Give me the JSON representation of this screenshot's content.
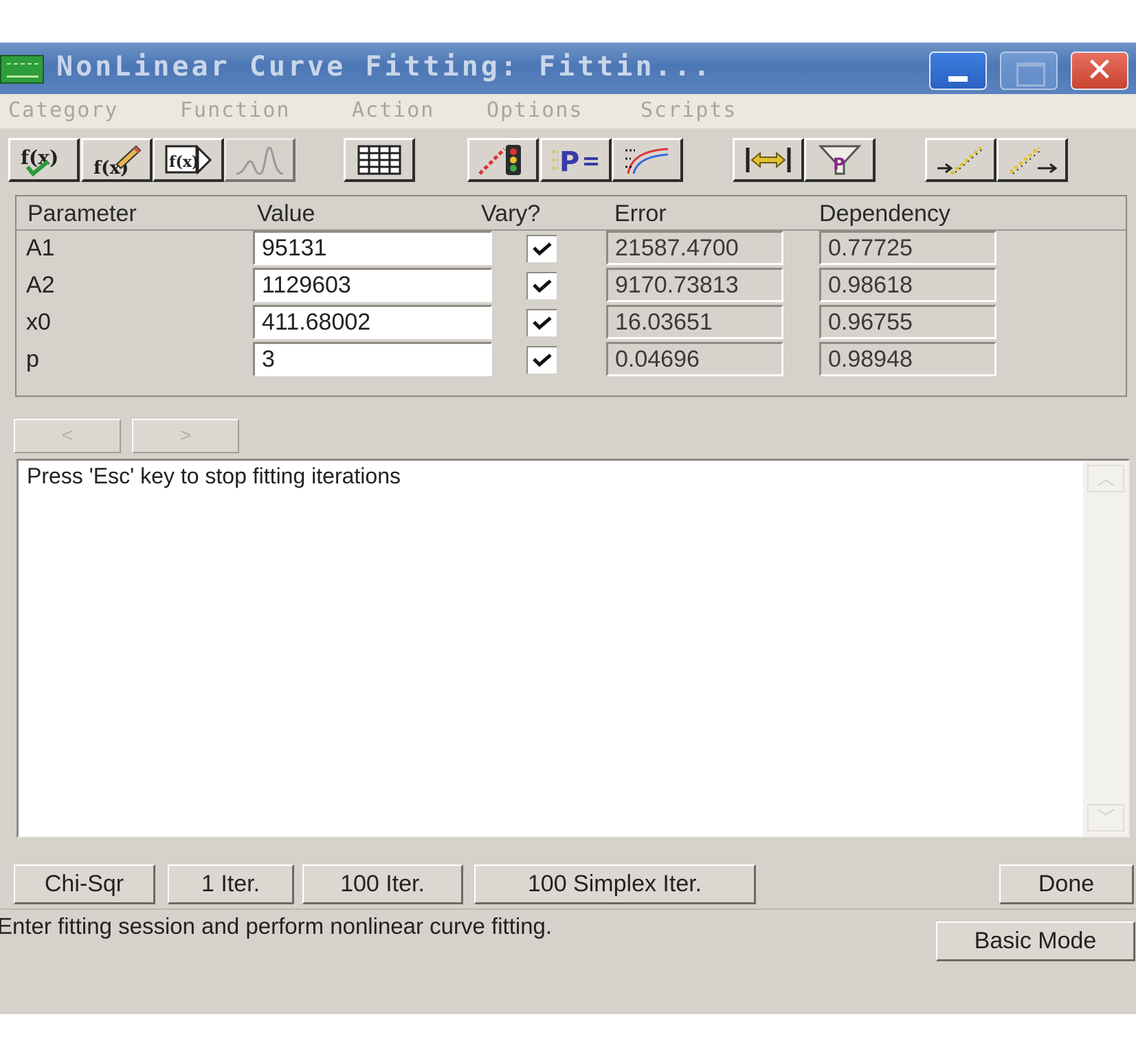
{
  "window": {
    "title": "NonLinear Curve Fitting:  Fittin...",
    "controls": {
      "minimize": "minimize-icon",
      "maximize": "maximize-icon",
      "close": "close-icon"
    }
  },
  "menu": [
    "Category",
    "Function",
    "Action",
    "Options",
    "Scripts"
  ],
  "toolbar": [
    {
      "icon": "fx-check-icon"
    },
    {
      "icon": "fx-edit-icon"
    },
    {
      "icon": "fx-new-icon"
    },
    {
      "icon": "peaks-icon"
    },
    {
      "icon": "worksheet-icon"
    },
    {
      "icon": "traffic-light-icon"
    },
    {
      "icon": "parameters-icon"
    },
    {
      "icon": "simulate-curve-icon"
    },
    {
      "icon": "range-icon"
    },
    {
      "icon": "funnel-p-icon"
    },
    {
      "icon": "fit-start-icon"
    },
    {
      "icon": "fit-end-icon"
    }
  ],
  "grid": {
    "headers": {
      "parameter": "Parameter",
      "value": "Value",
      "vary": "Vary?",
      "error": "Error",
      "dependency": "Dependency"
    },
    "rows": [
      {
        "name": "A1",
        "value": "95131",
        "vary": true,
        "error": "21587.4700",
        "dependency": "0.77725"
      },
      {
        "name": "A2",
        "value": "1129603",
        "vary": true,
        "error": "9170.73813",
        "dependency": "0.98618"
      },
      {
        "name": "x0",
        "value": "411.68002",
        "vary": true,
        "error": "16.03651",
        "dependency": "0.96755"
      },
      {
        "name": "p",
        "value": "3",
        "vary": true,
        "error": "0.04696",
        "dependency": "0.98948"
      }
    ]
  },
  "nav": {
    "prev": "<",
    "next": ">"
  },
  "output": {
    "text": "Press 'Esc' key to stop fitting iterations"
  },
  "buttons": {
    "chisqr": "Chi-Sqr",
    "iter1": "1 Iter.",
    "iter100": "100 Iter.",
    "simplex": "100 Simplex Iter.",
    "done": "Done",
    "basic_mode": "Basic Mode"
  },
  "status": "Enter fitting session and perform nonlinear curve fitting.",
  "colors": {
    "title_bar": "#4c77b5",
    "dialog_bg": "#d5d1cb",
    "close_button": "#c9432f"
  }
}
